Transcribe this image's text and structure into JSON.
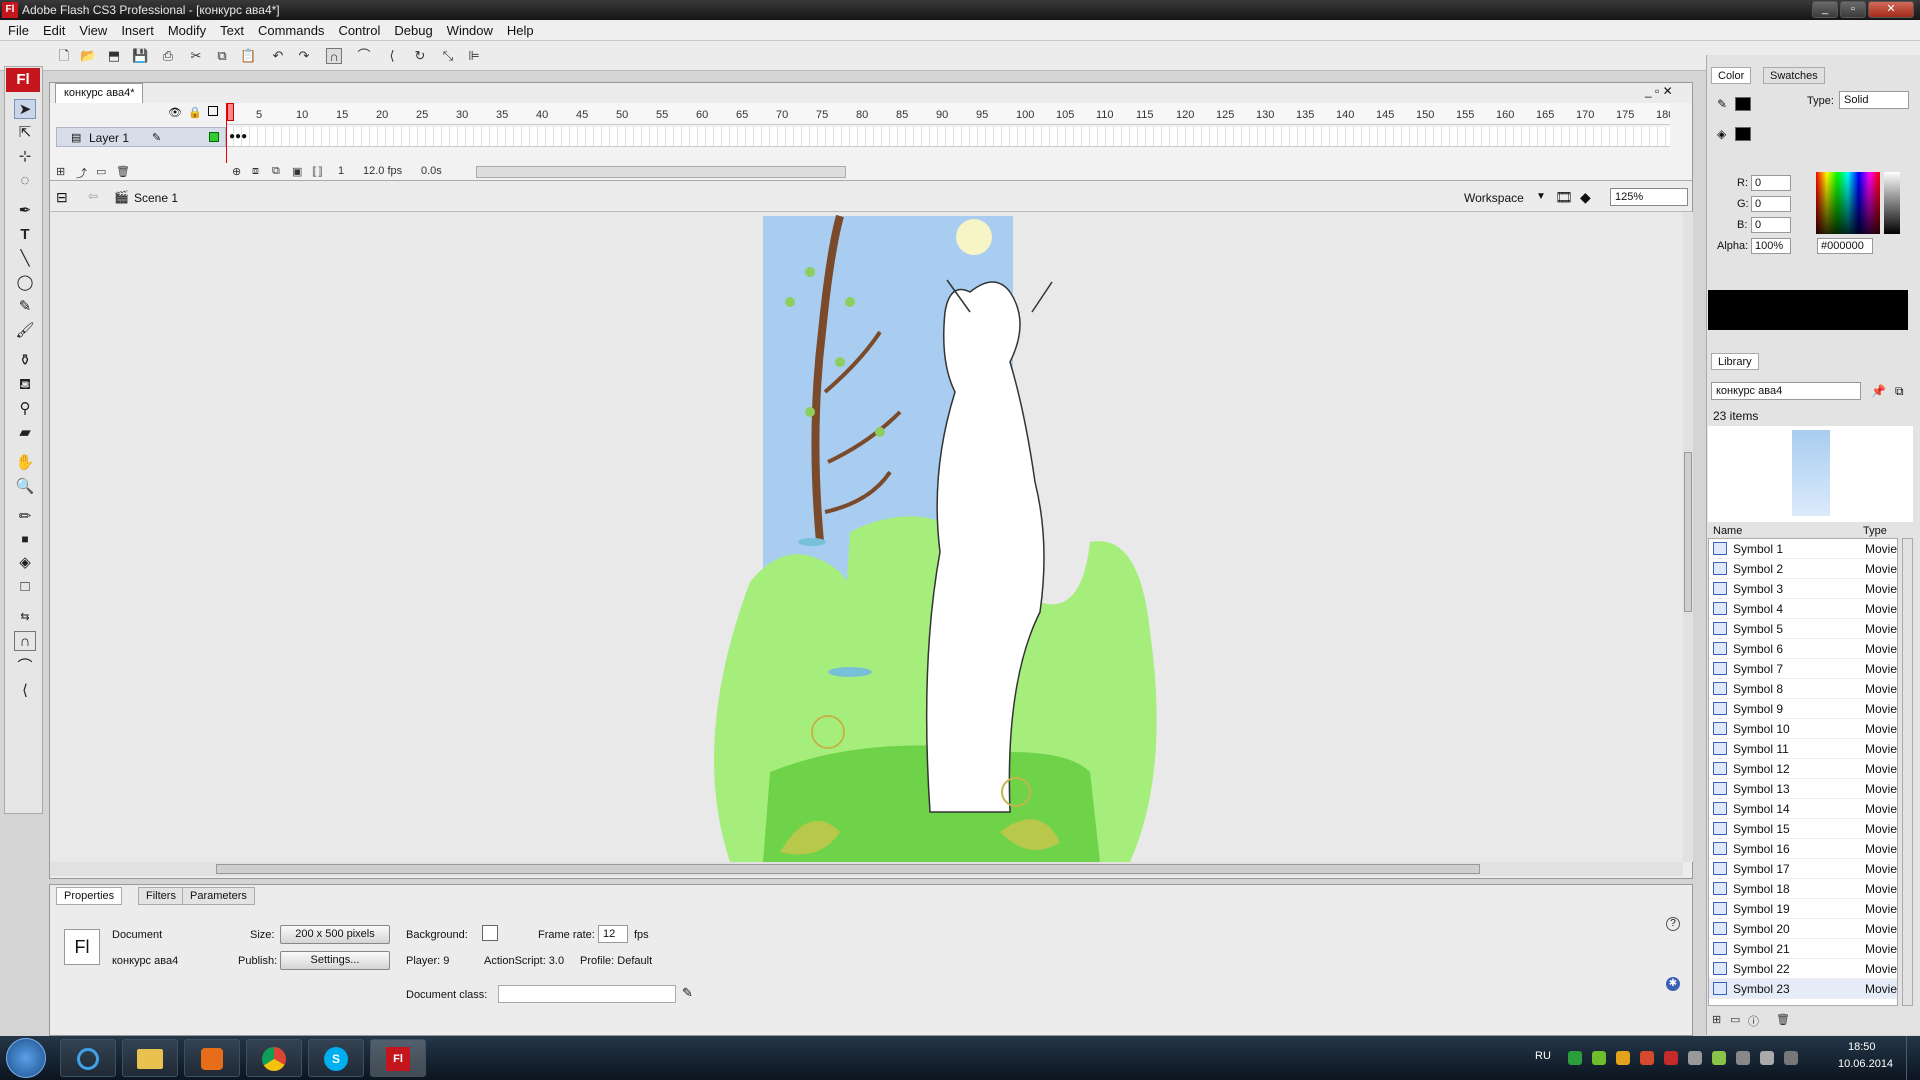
{
  "window": {
    "title": "Adobe Flash CS3 Professional - [конкурс ава4*]",
    "app_badge": "Fl"
  },
  "menu": [
    "File",
    "Edit",
    "View",
    "Insert",
    "Modify",
    "Text",
    "Commands",
    "Control",
    "Debug",
    "Window",
    "Help"
  ],
  "doc_tab": "конкурс ава4*",
  "timeline": {
    "layer_name": "Layer 1",
    "ruler": [
      "5",
      "10",
      "15",
      "20",
      "25",
      "30",
      "35",
      "40",
      "45",
      "50",
      "55",
      "60",
      "65",
      "70",
      "75",
      "80",
      "85",
      "90",
      "95",
      "100",
      "105",
      "110",
      "115",
      "120",
      "125",
      "130",
      "135",
      "140",
      "145",
      "150",
      "155",
      "160",
      "165",
      "170",
      "175",
      "180"
    ],
    "current_frame": "1",
    "fps": "12.0 fps",
    "time": "0.0s"
  },
  "scene": {
    "label": "Scene 1",
    "workspace": "Workspace",
    "zoom": "125%"
  },
  "properties": {
    "tabs": [
      "Properties",
      "Filters",
      "Parameters"
    ],
    "doc_icon": "Fl",
    "doc_label": "Document",
    "doc_name": "конкурс ава4",
    "size_label": "Size:",
    "size_value": "200 x 500 pixels",
    "background_label": "Background:",
    "frame_rate_label": "Frame rate:",
    "frame_rate": "12",
    "fps_unit": "fps",
    "publish_label": "Publish:",
    "settings_button": "Settings...",
    "player": "Player:  9",
    "actionscript": "ActionScript:  3.0",
    "profile": "Profile:  Default",
    "doc_class_label": "Document class:"
  },
  "color_panel": {
    "tabs": [
      "Color",
      "Swatches"
    ],
    "type_label": "Type:",
    "type_value": "Solid",
    "r_label": "R:",
    "r": "0",
    "g_label": "G:",
    "g": "0",
    "b_label": "B:",
    "b": "0",
    "alpha_label": "Alpha:",
    "alpha": "100%",
    "hex": "#000000",
    "current_color": "#000000"
  },
  "library": {
    "tab": "Library",
    "document": "конкурс ава4",
    "count": "23 items",
    "col_name": "Name",
    "col_type": "Type",
    "items": [
      {
        "name": "Symbol 1",
        "type": "Movie"
      },
      {
        "name": "Symbol 2",
        "type": "Movie"
      },
      {
        "name": "Symbol 3",
        "type": "Movie"
      },
      {
        "name": "Symbol 4",
        "type": "Movie"
      },
      {
        "name": "Symbol 5",
        "type": "Movie"
      },
      {
        "name": "Symbol 6",
        "type": "Movie"
      },
      {
        "name": "Symbol 7",
        "type": "Movie"
      },
      {
        "name": "Symbol 8",
        "type": "Movie"
      },
      {
        "name": "Symbol 9",
        "type": "Movie"
      },
      {
        "name": "Symbol 10",
        "type": "Movie"
      },
      {
        "name": "Symbol 11",
        "type": "Movie"
      },
      {
        "name": "Symbol 12",
        "type": "Movie"
      },
      {
        "name": "Symbol 13",
        "type": "Movie"
      },
      {
        "name": "Symbol 14",
        "type": "Movie"
      },
      {
        "name": "Symbol 15",
        "type": "Movie"
      },
      {
        "name": "Symbol 16",
        "type": "Movie"
      },
      {
        "name": "Symbol 17",
        "type": "Movie"
      },
      {
        "name": "Symbol 18",
        "type": "Movie"
      },
      {
        "name": "Symbol 19",
        "type": "Movie"
      },
      {
        "name": "Symbol 20",
        "type": "Movie"
      },
      {
        "name": "Symbol 21",
        "type": "Movie"
      },
      {
        "name": "Symbol 22",
        "type": "Movie"
      },
      {
        "name": "Symbol 23",
        "type": "Movie"
      }
    ]
  },
  "taskbar": {
    "lang": "RU",
    "time": "18:50",
    "date": "10.06.2014",
    "apps": [
      "ie-icon",
      "explorer-icon",
      "media-player-icon",
      "chrome-icon",
      "skype-icon",
      "flash-icon"
    ]
  }
}
